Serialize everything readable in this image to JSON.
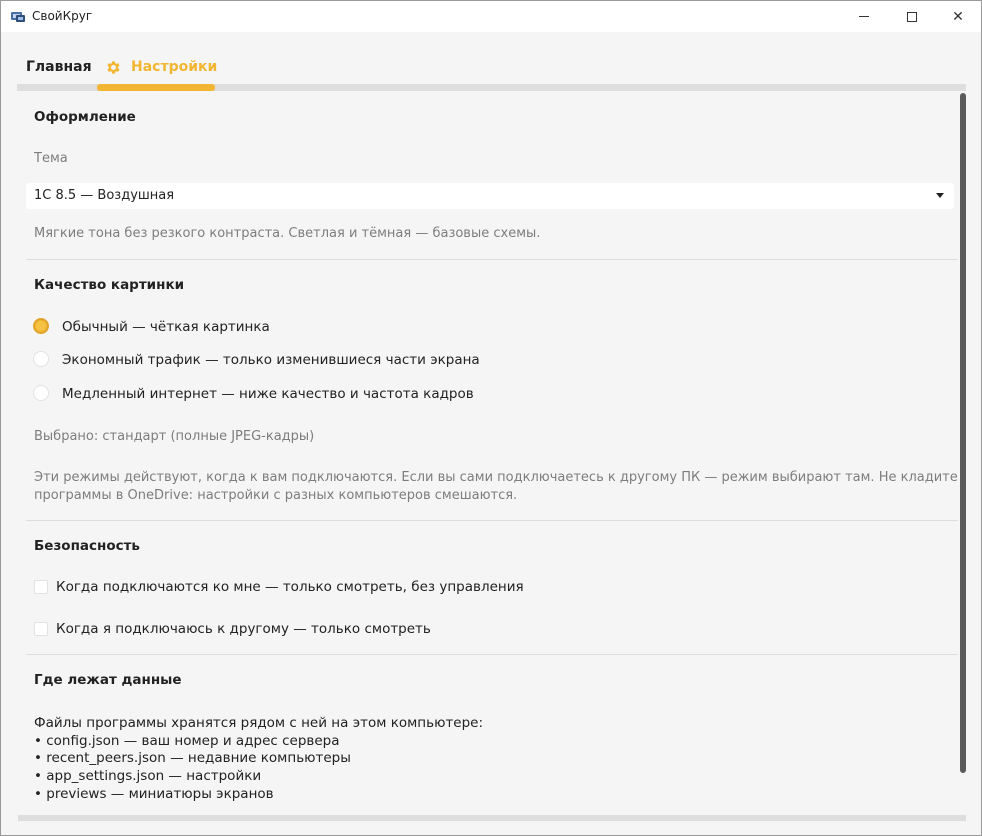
{
  "window": {
    "title": "СвойКруг",
    "minimize_icon": "minimize-icon",
    "maximize_icon": "maximize-icon",
    "close_icon": "close-icon"
  },
  "tabs": [
    {
      "label": "Главная",
      "active": false
    },
    {
      "label": "Настройки",
      "active": true,
      "icon": "gear-icon"
    }
  ],
  "colors": {
    "accent": "#f2b632",
    "text": "#222222",
    "muted": "#7d7d7d"
  },
  "appearance": {
    "title": "Оформление",
    "theme_label": "Тема",
    "theme_value": "1С 8.5 — Воздушная",
    "theme_hint": "Мягкие тона без резкого контраста. Светлая и тёмная — базовые схемы."
  },
  "quality": {
    "title": "Качество картинки",
    "options": [
      {
        "label": "Обычный — чёткая картинка",
        "selected": true
      },
      {
        "label": "Экономный трафик — только изменившиеся части экрана",
        "selected": false
      },
      {
        "label": "Медленный интернет — ниже качество и частота кадров",
        "selected": false
      }
    ],
    "selected_text": "Выбрано: стандарт (полные JPEG-кадры)",
    "note_line1": "Эти режимы действуют, когда к вам подключаются. Если вы сами подключаетесь к другому ПК — режим выбирают там. Не кладите папку",
    "note_line2": "программы в OneDrive: настройки с разных компьютеров смешаются."
  },
  "security": {
    "title": "Безопасность",
    "options": [
      {
        "label": "Когда подключаются ко мне — только смотреть, без управления",
        "checked": false
      },
      {
        "label": "Когда я подключаюсь к другому — только смотреть",
        "checked": false
      }
    ]
  },
  "data_location": {
    "title": "Где лежат данные",
    "lines": [
      "Файлы программы хранятся рядом с ней на этом компьютере:",
      "• config.json — ваш номер и адрес сервера",
      "• recent_peers.json — недавние компьютеры",
      "• app_settings.json — настройки",
      "• previews — миниатюры экранов"
    ]
  }
}
